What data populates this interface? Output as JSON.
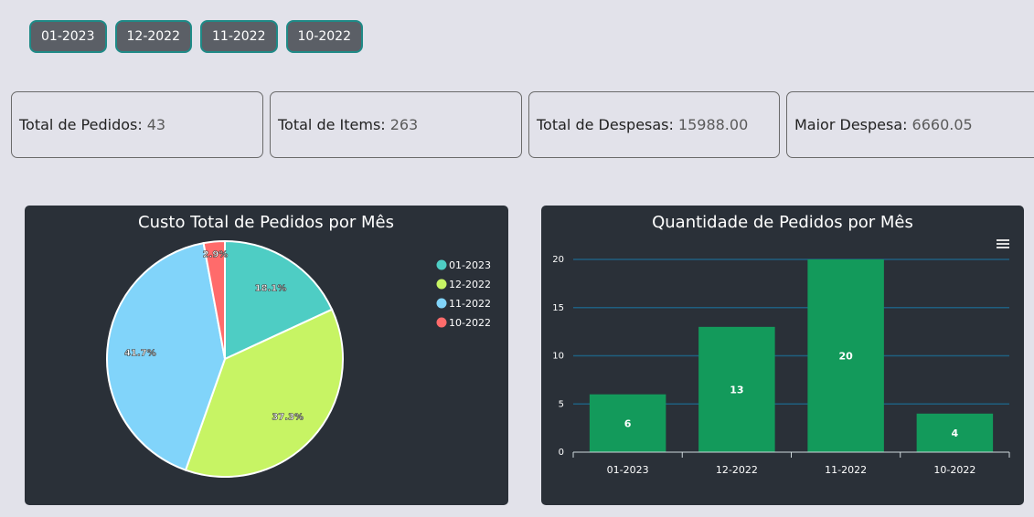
{
  "filters": [
    "01-2023",
    "12-2022",
    "11-2022",
    "10-2022"
  ],
  "stats": [
    {
      "label": "Total de Pedidos:",
      "value": "43"
    },
    {
      "label": "Total de Items:",
      "value": "263"
    },
    {
      "label": "Total de Despesas:",
      "value": "15988.00"
    },
    {
      "label": "Maior Despesa:",
      "value": "6660.05"
    }
  ],
  "colors": {
    "page_bg": "#e2e2ea",
    "card_bg": "#2a3038",
    "filter_bg": "#5b5f66",
    "filter_border": "#1f8a87",
    "bar": "#139a5b",
    "gridline": "#1f5f80"
  },
  "menu_icon": "hamburger-menu-icon",
  "chart_data": [
    {
      "type": "pie",
      "title": "Custo Total de Pedidos por Mês",
      "categories": [
        "01-2023",
        "12-2022",
        "11-2022",
        "10-2022"
      ],
      "values": [
        18.1,
        37.3,
        41.7,
        2.9
      ],
      "labels": [
        "18.1%",
        "37.3%",
        "41.7%",
        "2.9%"
      ],
      "colors": [
        "#4ecdc4",
        "#c7f464",
        "#81d4fa",
        "#ff6b6b"
      ],
      "legend": "right"
    },
    {
      "type": "bar",
      "title": "Quantidade de Pedidos por Mês",
      "categories": [
        "01-2023",
        "12-2022",
        "11-2022",
        "10-2022"
      ],
      "values": [
        6,
        13,
        20,
        4
      ],
      "yticks": [
        0,
        5,
        10,
        15,
        20
      ],
      "ylim": [
        0,
        20
      ],
      "grid": true,
      "color": "#139a5b"
    }
  ]
}
